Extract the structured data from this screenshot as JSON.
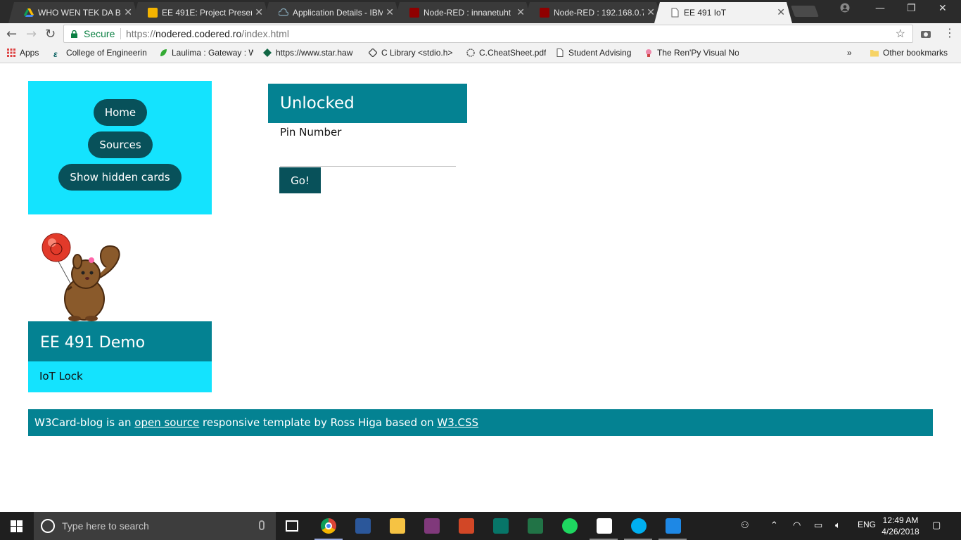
{
  "browser": {
    "tabs": [
      {
        "title": "WHO WEN TEK DA BIKE",
        "active": false
      },
      {
        "title": "EE 491E: Project Presen",
        "active": false
      },
      {
        "title": "Application Details - IBM",
        "active": false
      },
      {
        "title": "Node-RED : innanetuht",
        "active": false
      },
      {
        "title": "Node-RED : 192.168.0.7",
        "active": false
      },
      {
        "title": "EE 491 IoT",
        "active": true
      }
    ],
    "secure_label": "Secure",
    "url_scheme": "https://",
    "url_host": "nodered.codered.ro",
    "url_path": "/index.html",
    "bookmarks": [
      "Apps",
      "College of Engineerin",
      "Laulima : Gateway : W",
      "https://www.star.haw",
      "C Library <stdio.h>",
      "C.CheatSheet.pdf",
      "Student Advising",
      "The Ren'Py Visual No"
    ],
    "other_bookmarks": "Other bookmarks",
    "overflow_chevron": "»"
  },
  "page": {
    "nav": {
      "home": "Home",
      "sources": "Sources",
      "show_hidden": "Show hidden cards"
    },
    "demo_card": {
      "title": "EE 491 Demo",
      "subtitle": "IoT Lock"
    },
    "lock_card": {
      "status": "Unlocked",
      "pin_label": "Pin Number",
      "pin_value": "",
      "go_label": "Go!"
    },
    "footer": {
      "prefix": "W3Card-blog is an ",
      "link1": "open source",
      "middle": " responsive template by Ross Higa based on ",
      "link2": "W3.CSS"
    },
    "colors": {
      "cyan": "#14e3fe",
      "teal": "#048292",
      "dark_teal": "#08515a"
    }
  },
  "taskbar": {
    "search_placeholder": "Type here to search",
    "language": "ENG",
    "time": "12:49 AM",
    "date": "4/26/2018",
    "apps": [
      "chrome-icon",
      "word-icon",
      "file-explorer-icon",
      "onenote-icon",
      "powerpoint-icon",
      "publisher-icon",
      "excel-icon",
      "spotify-icon",
      "sticky-notes-icon",
      "skype-icon",
      "vscode-icon"
    ]
  }
}
